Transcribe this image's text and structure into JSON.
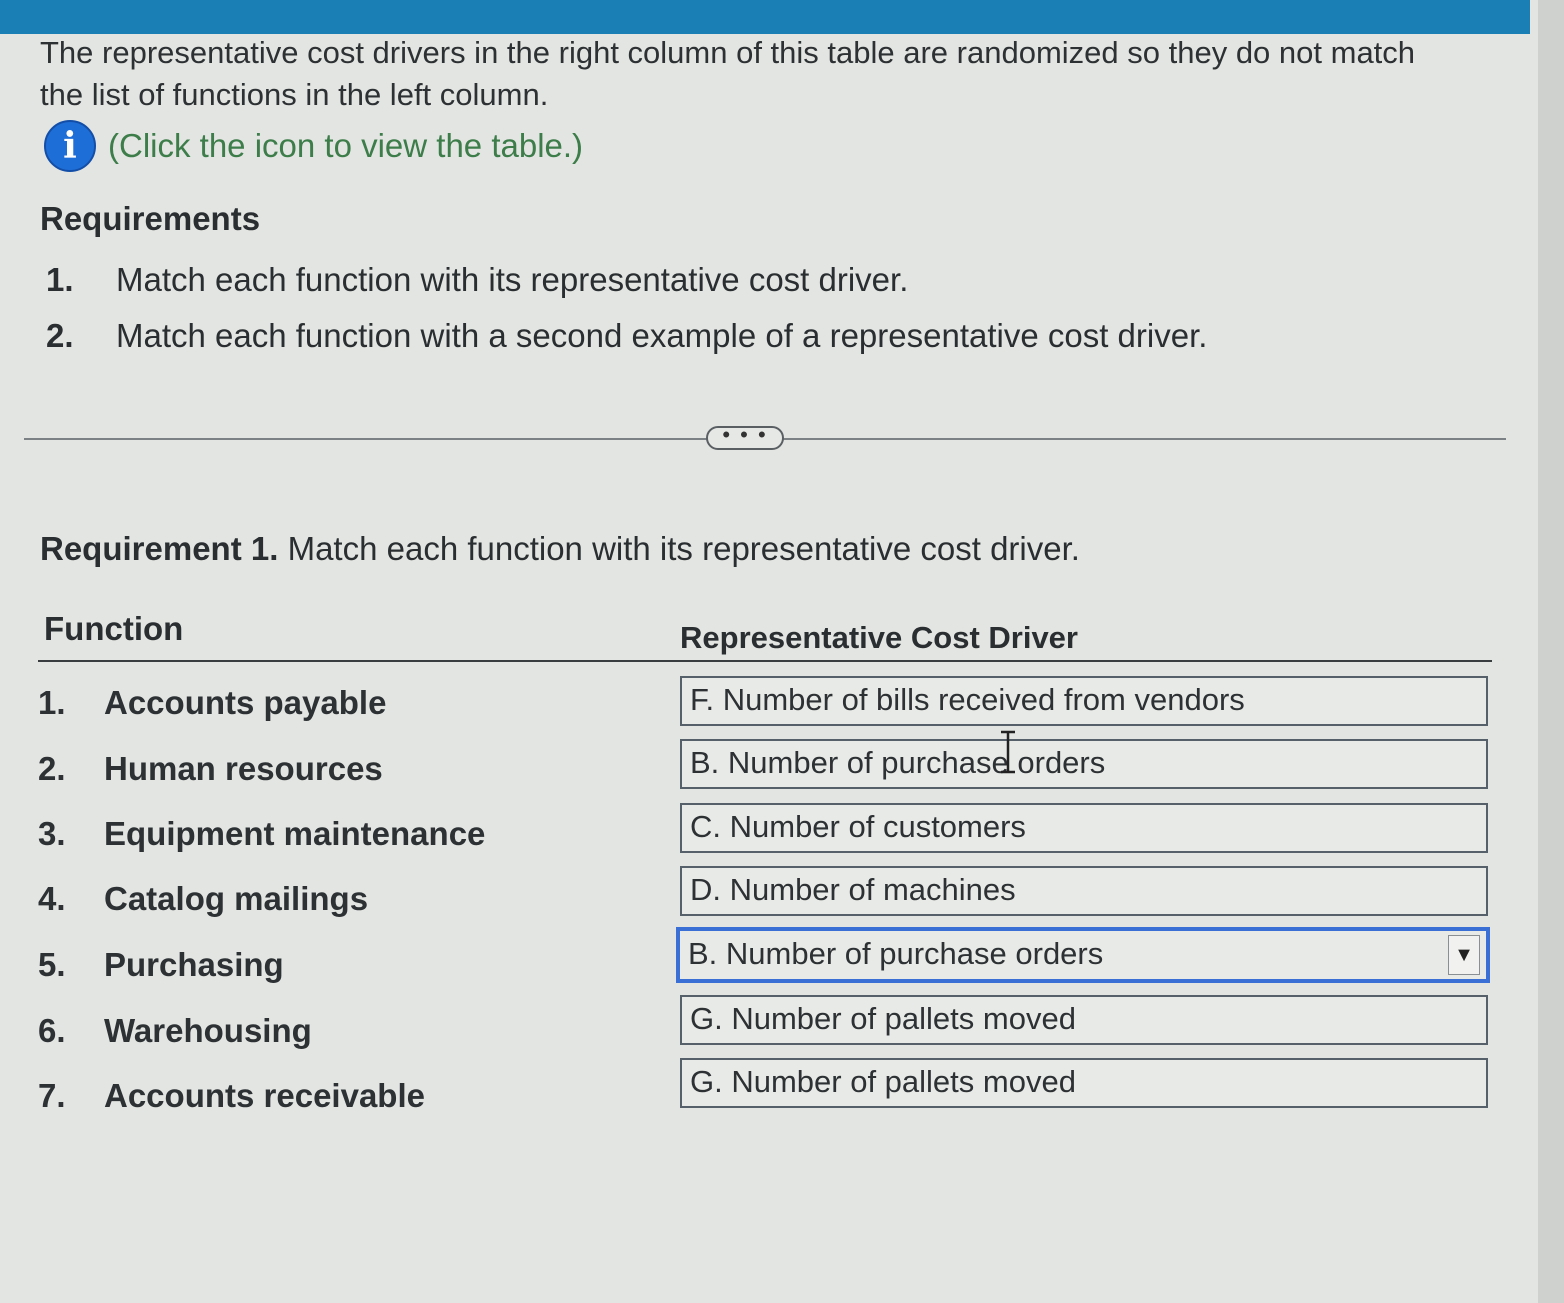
{
  "intro": {
    "text": "The representative cost drivers in the right column of this table are randomized so they do not match the list of functions in the left column.",
    "info_link": "(Click the icon to view the table.)",
    "info_icon_glyph": "i"
  },
  "requirements": {
    "heading": "Requirements",
    "items": [
      {
        "num": "1.",
        "text": "Match each function with its representative cost driver."
      },
      {
        "num": "2.",
        "text": "Match each function with a second example of a representative cost driver."
      }
    ]
  },
  "expand_button": "• • •",
  "requirement1": {
    "title_bold": "Requirement 1.",
    "title_rest": " Match each function with its representative cost driver.",
    "col_function": "Function",
    "col_driver": "Representative Cost Driver",
    "rows": [
      {
        "num": "1.",
        "function": "Accounts payable",
        "driver": "F. Number of bills received from vendors"
      },
      {
        "num": "2.",
        "function": "Human resources",
        "driver": "B. Number of purchase orders"
      },
      {
        "num": "3.",
        "function": "Equipment maintenance",
        "driver": "C. Number of customers"
      },
      {
        "num": "4.",
        "function": "Catalog mailings",
        "driver": "D. Number of machines"
      },
      {
        "num": "5.",
        "function": "Purchasing",
        "driver": "B. Number of purchase orders"
      },
      {
        "num": "6.",
        "function": "Warehousing",
        "driver": "G. Number of pallets moved"
      },
      {
        "num": "7.",
        "function": "Accounts receivable",
        "driver": "G. Number of pallets moved"
      }
    ],
    "dropdown_arrow": "▼"
  },
  "colors": {
    "top_bar": "#1a7fb5",
    "info_icon": "#1e6ed8",
    "info_link": "#3d7d4a",
    "active_select_border": "#3a6fd6"
  }
}
